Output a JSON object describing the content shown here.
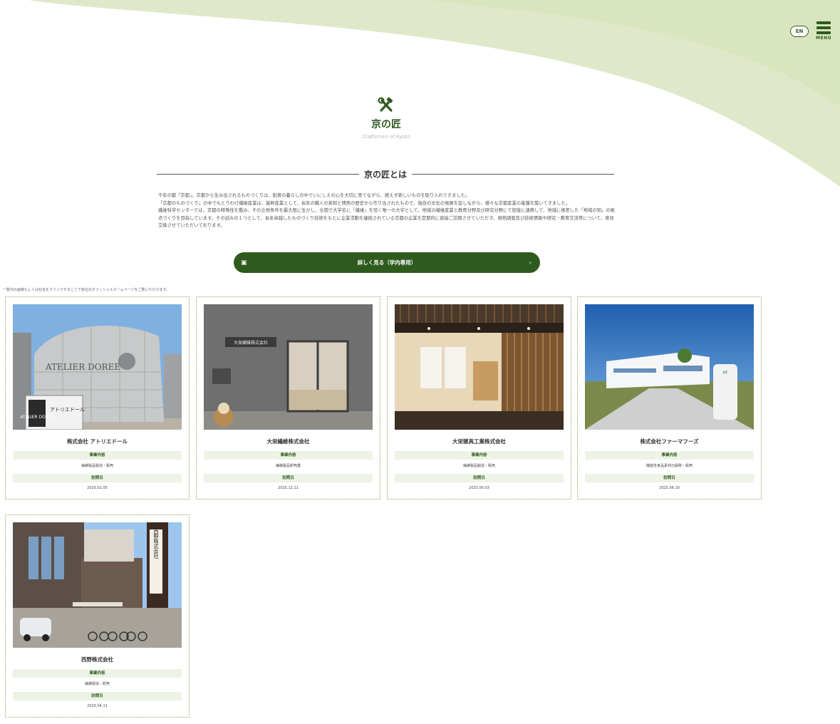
{
  "header": {
    "lang_label": "EN",
    "menu_label": "MENU"
  },
  "hero": {
    "title": "京の匠",
    "subtitle": "Craftsmen of Kyoto",
    "logo_icon": "hammer-wrench-icon"
  },
  "about": {
    "heading": "京の匠とは",
    "paragraphs": [
      "千年の都「京都」。京都から生み出されるものづくりは、創意の暮らしの中でいにしえの心を大切に育てながら、絶えず新しいものを取り入れてきました。",
      "「京都のものづくり」の中でもとりわけ繊維産業は、基幹産業として、長年の職人の英知と情熱の歴史から作り出されたもので、独自の文化の発展を促しながら、様々な京都産業の基盤を築いてきました。",
      "繊維科学センターでは、京都の特殊性を鑑み、その立地条件を最大限に生かし、全国で大学名に「繊維」を冠く唯一の大学として、地域の繊維産業と教育分野及び研究分野にて密接に連携して、地域に根差した「地域の知」の拠点づくりを目指しています。その試みの１つとして、長年卓越したものづくり技術をもとに企業活動を継続されている京都の企業を定期的に直接ご訪問させていただき、現地調査及び技術情報や研究・教育交流等について、意見交換させていただいております。"
    ],
    "button_label": "詳しく見る（学内専用）"
  },
  "note": "一覧内の画像もしくは社名をクリックすることで各社のオフィシャルホームページをご覧いただけます。",
  "labels": {
    "business": "事業内容",
    "visit_date": "訪問日"
  },
  "companies": [
    {
      "name": "株式会社 アトリエドール",
      "business": "繊維製品製造・販売",
      "date": "2025.02.05",
      "sign": "ATELIER DOREE"
    },
    {
      "name": "大栄繊維株式会社",
      "business": "繊維製品卸売業",
      "date": "2025.12.11",
      "sign": "大栄繊維株式会社"
    },
    {
      "name": "大栄寝具工業株式会社",
      "business": "繊維製品製造・販売",
      "date": "2025.09.03",
      "sign": ""
    },
    {
      "name": "株式会社ファーマフーズ",
      "business": "機能性食品素材の開発・販売",
      "date": "2025.06.19",
      "sign": ""
    },
    {
      "name": "西野株式会社",
      "business": "繊維製造・卸売",
      "date": "2025.04.11",
      "sign": "西野株式会社"
    }
  ],
  "colors": {
    "brand_green": "#2f5a1e",
    "swoosh": "#dfe9c9",
    "band": "#edf3e5"
  }
}
